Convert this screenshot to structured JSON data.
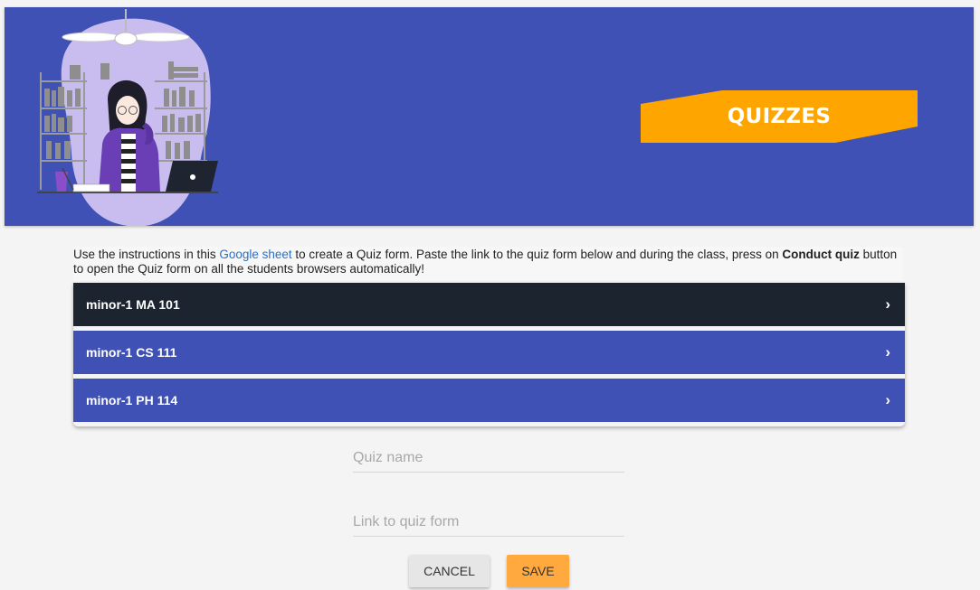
{
  "banner": {
    "title": "QUIZZES",
    "color": "#3f51b5",
    "ribbon_color": "#ffa500",
    "illustration": "student-studying-illustration"
  },
  "instructions": {
    "prefix": "Use the instructions in this ",
    "link_text": "Google sheet",
    "middle": " to create a Quiz form. Paste the link to the quiz form below and during the class, press on ",
    "bold_text": "Conduct quiz",
    "suffix": " button to open the Quiz form on all the students browsers automatically!"
  },
  "quizzes": [
    {
      "label": "minor-1 MA 101",
      "color": "#1c2430",
      "state": "selected"
    },
    {
      "label": "minor-1 CS 111",
      "color": "#3f51b5",
      "state": "default"
    },
    {
      "label": "minor-1 PH 114",
      "color": "#3f51b5",
      "state": "default"
    }
  ],
  "chevron_icon": "chevron-right-icon",
  "form": {
    "quiz_name": {
      "placeholder": "Quiz name",
      "value": ""
    },
    "quiz_link": {
      "placeholder": "Link to quiz form",
      "value": ""
    }
  },
  "buttons": {
    "cancel": {
      "label": "CANCEL",
      "color": "#e6e6e6"
    },
    "save": {
      "label": "SAVE",
      "color": "#ffa93f"
    }
  }
}
